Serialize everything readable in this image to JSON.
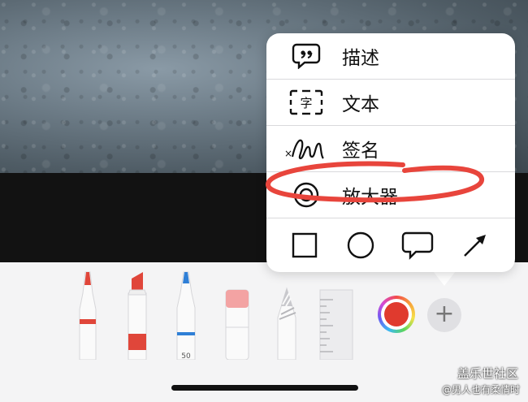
{
  "markup_menu": {
    "items": [
      {
        "label": "描述",
        "icon": "quote-bubble-icon"
      },
      {
        "label": "文本",
        "icon": "text-box-icon",
        "icon_glyph": "字"
      },
      {
        "label": "签名",
        "icon": "signature-icon"
      },
      {
        "label": "放大器",
        "icon": "magnifier-icon"
      }
    ],
    "shapes": [
      {
        "name": "square-shape-icon"
      },
      {
        "name": "circle-shape-icon"
      },
      {
        "name": "speech-bubble-shape-icon"
      },
      {
        "name": "arrow-shape-icon"
      }
    ]
  },
  "toolbar": {
    "tools": [
      {
        "name": "pen-tool",
        "tip_color": "#e0463a"
      },
      {
        "name": "highlighter-tool",
        "tip_color": "#e0463a"
      },
      {
        "name": "pencil-tool",
        "tip_color": "#2f7fd6",
        "number": "50"
      },
      {
        "name": "eraser-tool",
        "tip_color": "#f0a0a0"
      },
      {
        "name": "lasso-tool",
        "tip_color": "#c8c8cc"
      },
      {
        "name": "ruler-tool",
        "tip_color": "#e6e6e8"
      }
    ],
    "selected_color": "#e03a2e",
    "add_label": "+"
  },
  "watermark": {
    "line1": "盖乐世社区",
    "line2": "@男人也有柔情时"
  },
  "annotation_color": "#e8453c"
}
